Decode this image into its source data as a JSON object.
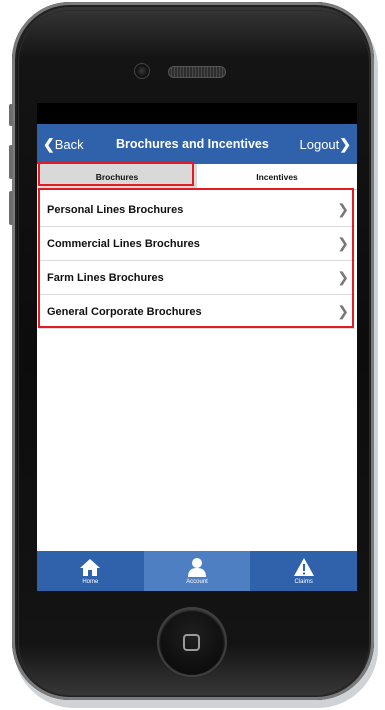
{
  "nav": {
    "back_label": "Back",
    "title": "Brochures and Incentives",
    "logout_label": "Logout"
  },
  "tabs": [
    {
      "label": "Brochures",
      "active": true
    },
    {
      "label": "Incentives",
      "active": false
    }
  ],
  "list": [
    {
      "label": "Personal Lines Brochures"
    },
    {
      "label": "Commercial Lines Brochures"
    },
    {
      "label": "Farm Lines Brochures"
    },
    {
      "label": "General Corporate Brochures"
    }
  ],
  "tabbar": [
    {
      "label": "Home",
      "icon": "home-icon"
    },
    {
      "label": "Account",
      "icon": "person-icon",
      "active": true
    },
    {
      "label": "Claims",
      "icon": "warning-icon"
    }
  ],
  "colors": {
    "nav_blue": "#2f62aa",
    "highlight_red": "#e21c23",
    "active_tab_gray": "#d9d9d9"
  }
}
